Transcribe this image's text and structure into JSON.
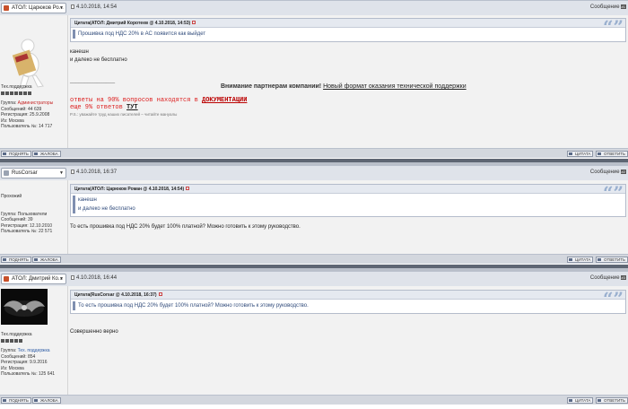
{
  "posts": [
    {
      "author": "ATOЛ: Царюков Ро...",
      "date": "4.10.2018, 14:54",
      "msg_label": "Сообщение",
      "msg_no": "#1",
      "rank": "Тех.поддержка",
      "group_label": "Группа:",
      "group": "Администраторы",
      "messages": "Сообщений: 44 639",
      "registered": "Регистрация: 25.9.2008",
      "from": "Из: Москва",
      "user_no": "Пользователь №: 14 717",
      "quote_head": "Цитата(ATOЛ: Дмитрий Коротеев @ 4.10.2018, 14:53)",
      "quote_text": "Прошивка под НДС 20% в АС появится как выйдет",
      "body": [
        "канешн",
        "и далеко не бесплатно"
      ],
      "sig_dash": "_______________",
      "sig_attention": "Внимание партнерам компании!",
      "sig_link": "Новый формат оказания технической поддержки",
      "sig_line1_a": "ответы на 90% вопросов находятся в",
      "sig_line1_b": "ДОКУМЕНТАЦИИ",
      "sig_line2_a": "еще 9% ответов",
      "sig_line2_b": "ТУТ",
      "sig_ps": "P.S.: уважайте труд наших писателей – читайте мануалы"
    },
    {
      "author": "RusCorsar",
      "date": "4.10.2018, 16:37",
      "msg_label": "Сообщение",
      "msg_no": "#2",
      "rank": "Прохожий",
      "group_label": "Группа:",
      "group": "Пользователи",
      "messages": "Сообщений: 39",
      "registered": "Регистрация: 12.10.2010",
      "user_no": "Пользователь №: 22 571",
      "quote_head": "Цитата(ATOЛ: Царюков Роман @ 4.10.2018, 14:54)",
      "quote_lines": [
        "канешн",
        "и далеко не бесплатно"
      ],
      "body": [
        "То есть прошивка под НДС 20% будет 100% платной? Можно готовить к этому руководство."
      ]
    },
    {
      "author": "ATOЛ: Дмитрий Ко...",
      "date": "4.10.2018, 16:44",
      "msg_label": "Сообщение",
      "msg_no": "#3",
      "rank": "Тех.поддержка",
      "group_label": "Группа:",
      "group": "Тех. поддержка",
      "messages": "Сообщений: 854",
      "registered": "Регистрация: 9.9.2016",
      "from": "Из: Москва",
      "user_no": "Пользователь №: 125 641",
      "quote_head": "Цитата(RusCorsar @ 4.10.2018, 16:37)",
      "quote_text": "То есть прошивка под НДС 20% будет 100% платной? Можно готовить к этому руководство.",
      "body": [
        "Совершенно верно"
      ]
    }
  ],
  "buttons": {
    "up": "ПОДНЯТЬ",
    "complain": "ЖАЛОБА",
    "quote": "ЦИТАТА",
    "reply": "ОТВЕТИТЬ"
  }
}
